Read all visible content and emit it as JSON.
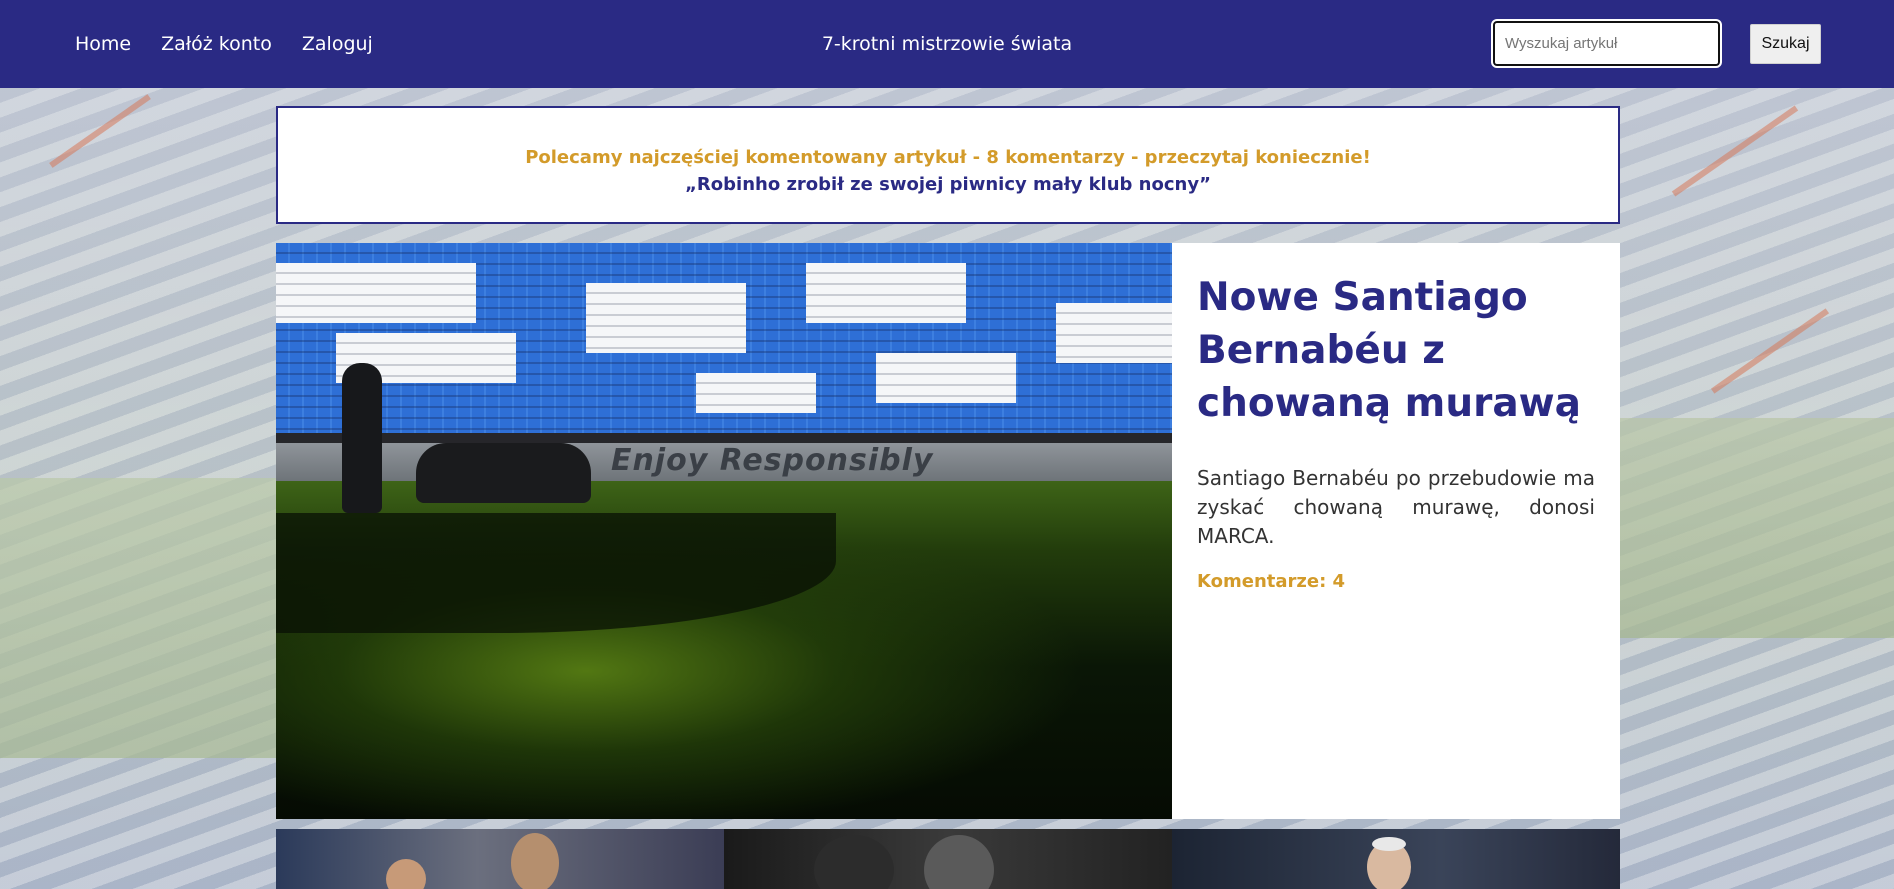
{
  "navbar": {
    "links": [
      "Home",
      "Załóż konto",
      "Zaloguj"
    ],
    "center_text": "7-krotni mistrzowie świata",
    "search_placeholder": "Wyszukaj artykuł",
    "search_button": "Szukaj"
  },
  "recommend": {
    "line1": "Polecamy najczęściej komentowany artykuł - 8 komentarzy - przeczytaj koniecznie!",
    "line2": "„Robinho zrobił ze swojej piwnicy mały klub nocny”"
  },
  "featured": {
    "title": "Nowe Santiago Bernabéu z chowaną murawą",
    "description": "Santiago Bernabéu po przebudowie ma zyskać chowaną murawę, donosi MARCA.",
    "comments": "Komentarze: 4",
    "image_text": "Enjoy Responsibly"
  },
  "colors": {
    "navbar": "#2a2a84",
    "accent_gold": "#d39b2a",
    "accent_navy": "#2a2a84"
  }
}
